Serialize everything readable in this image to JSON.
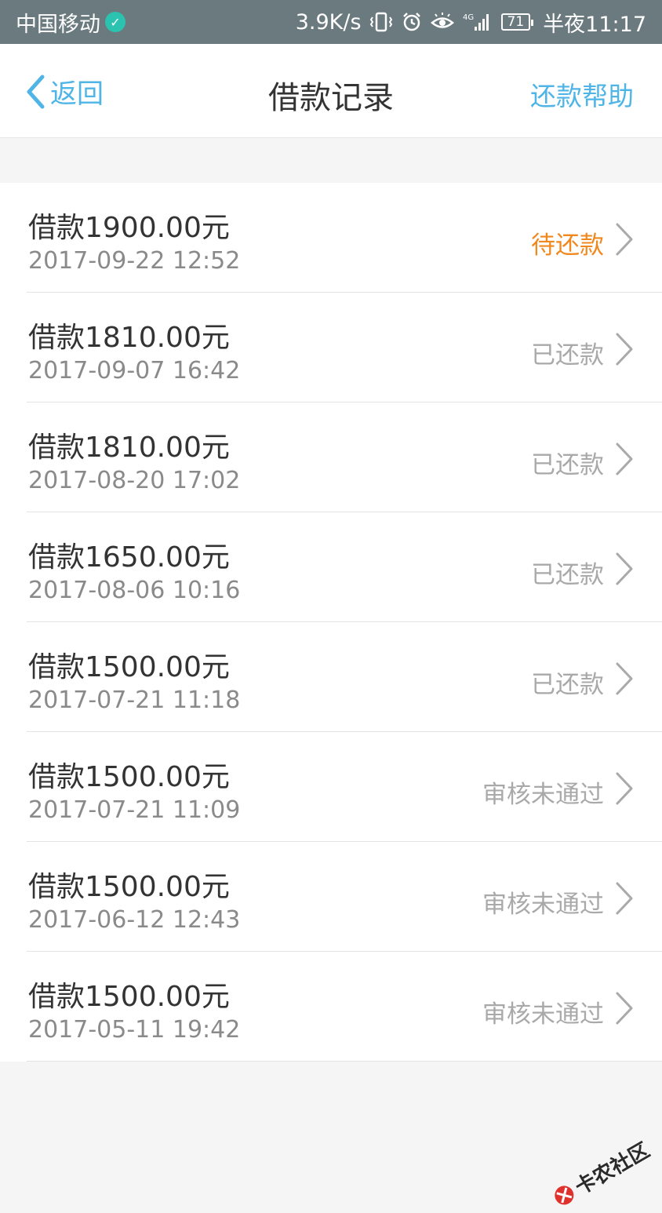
{
  "status_bar": {
    "carrier": "中国移动",
    "speed": "3.9K/s",
    "battery": "71",
    "time": "半夜11:17"
  },
  "nav": {
    "back_label": "返回",
    "title": "借款记录",
    "help_label": "还款帮助"
  },
  "records": [
    {
      "amount": "借款1900.00元",
      "date": "2017-09-22 12:52",
      "status": "待还款"
    },
    {
      "amount": "借款1810.00元",
      "date": "2017-09-07 16:42",
      "status": "已还款"
    },
    {
      "amount": "借款1810.00元",
      "date": "2017-08-20 17:02",
      "status": "已还款"
    },
    {
      "amount": "借款1650.00元",
      "date": "2017-08-06 10:16",
      "status": "已还款"
    },
    {
      "amount": "借款1500.00元",
      "date": "2017-07-21 11:18",
      "status": "已还款"
    },
    {
      "amount": "借款1500.00元",
      "date": "2017-07-21 11:09",
      "status": "审核未通过"
    },
    {
      "amount": "借款1500.00元",
      "date": "2017-06-12 12:43",
      "status": "审核未通过"
    },
    {
      "amount": "借款1500.00元",
      "date": "2017-05-11 19:42",
      "status": "审核未通过"
    }
  ],
  "colors": {
    "accent": "#4fb5e6",
    "pending": "#f0881e",
    "muted": "#a9a9a9"
  },
  "watermark": {
    "text": "卡农社区"
  }
}
